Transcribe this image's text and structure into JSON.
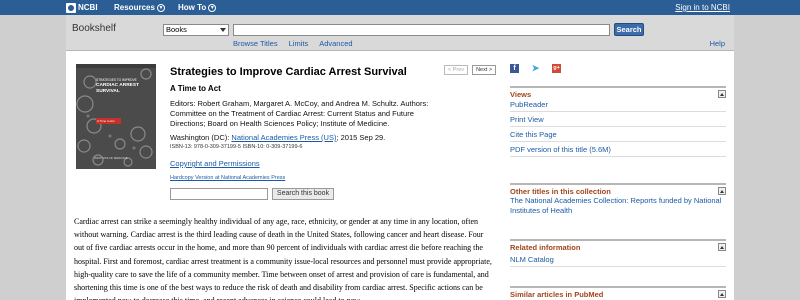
{
  "ncbi": {
    "logo": "NCBI",
    "resources": "Resources",
    "howto": "How To",
    "signin": "Sign in to NCBI"
  },
  "search": {
    "section": "Bookshelf",
    "database": "Books",
    "term": "",
    "button": "Search",
    "links": [
      "Browse Titles",
      "Limits",
      "Advanced"
    ],
    "help": "Help"
  },
  "book": {
    "title": "Strategies to Improve Cardiac Arrest Survival",
    "subtitle": "A Time to Act",
    "editors": "Editors: Robert Graham, Margaret A. McCoy, and Andrea M. Schultz. Authors: Committee on the Treatment of Cardiac Arrest: Current Status and Future Directions; Board on Health Sciences Policy; Institute of Medicine.",
    "place": "Washington (DC):",
    "publisher": "National Academies Press (US)",
    "date": "; 2015 Sep 29.",
    "isbn": "ISBN-13: 978-0-309-37199-5   ISBN-10: 0-309-37199-6",
    "copyright": "Copyright and Permissions",
    "hardcopy": "Hardcopy Version at National Academies Press",
    "search_button": "Search this book",
    "prev": "< Prev",
    "next": "Next >",
    "cover": {
      "line1": "STRATEGIES TO IMPROVE",
      "line2": "CARDIAC ARREST",
      "line3": "SURVIVAL",
      "tag": "A Time to Act",
      "foot": "INSTITUTE OF MEDICINE"
    },
    "abstract": "Cardiac arrest can strike a seemingly healthy individual of any age, race, ethnicity, or gender at any time in any location, often without warning. Cardiac arrest is the third leading cause of death in the United States, following cancer and heart disease. Four out of five cardiac arrests occur in the home, and more than 90 percent of individuals with cardiac arrest die before reaching the hospital. First and foremost, cardiac arrest treatment is a community issue-local resources and personnel must provide appropriate, high-quality care to save the life of a community member. Time between onset of arrest and provision of care is fundamental, and shortening this time is one of the best ways to reduce the risk of death and disability from cardiac arrest. Specific actions can be implemented now to decrease this time, and recent advances in science could lead to new"
  },
  "sidebar": {
    "views_title": "Views",
    "views": [
      "PubReader",
      "Print View",
      "Cite this Page",
      "PDF version of this title (5.6M)"
    ],
    "other_title": "Other titles in this collection",
    "other_text": "The National Academies Collection: Reports funded by National Institutes of Health",
    "related_title": "Related information",
    "related": [
      "NLM Catalog"
    ],
    "similar_title": "Similar articles in PubMed"
  },
  "colors": {
    "ncbi_blue": "#2a5e95",
    "link": "#1b5aa6",
    "panel_heading": "#a0451d"
  }
}
